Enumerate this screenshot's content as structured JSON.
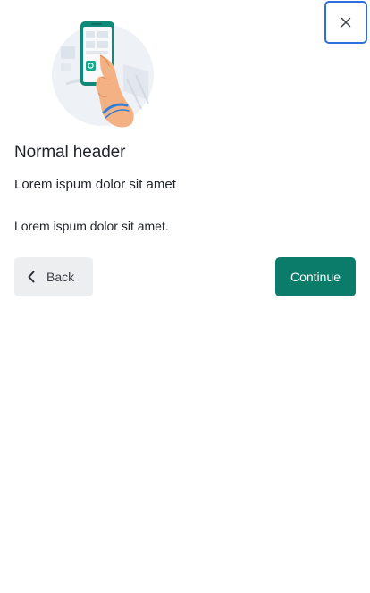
{
  "dialog": {
    "close_icon": "close-icon",
    "illustration": "hand-holding-phone-illustration",
    "title": "Normal header",
    "subtitle": "Lorem ispum dolor sit amet",
    "body": "Lorem ispum dolor sit amet.",
    "back_label": "Back",
    "back_icon": "chevron-left-icon",
    "continue_label": "Continue"
  },
  "colors": {
    "primary": "#0b7c6a",
    "focus_outline": "#2f6fdd",
    "secondary_bg": "#eceef0",
    "text": "#1f2328"
  }
}
